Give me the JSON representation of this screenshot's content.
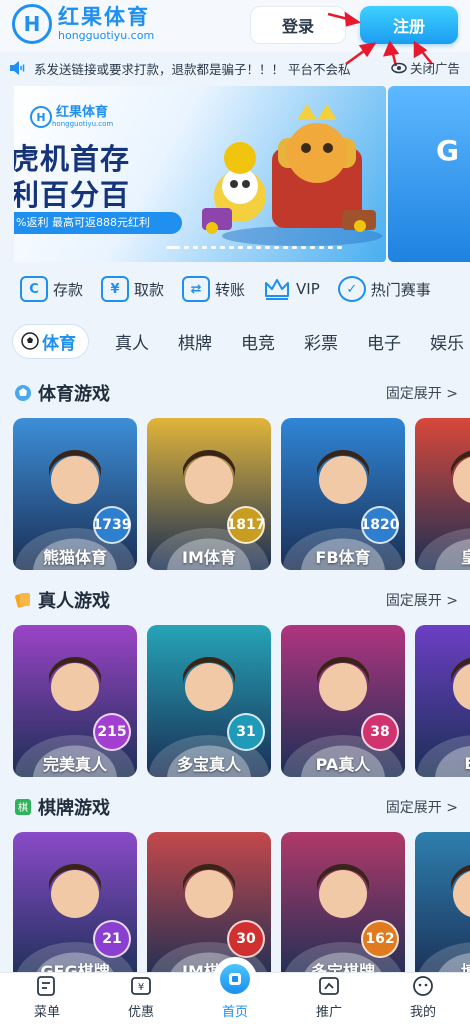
{
  "header": {
    "logo_mark": "H",
    "logo_title": "红果体育",
    "logo_sub": "hongguotiyu.com",
    "login_label": "登录",
    "register_label": "注册"
  },
  "marquee": {
    "text": "系发送链接或要求打款，退款都是骗子！！！ 平台不会私",
    "close_ad_label": "关闭广告",
    "icon": "speaker-icon"
  },
  "banner": {
    "logo_title": "红果体育",
    "logo_sub": "hongguotiyu.com",
    "headline_1": "虎机首存",
    "headline_2": "利百分百",
    "tag": "%返利 最高可返888元红利",
    "next_slide_text": "G"
  },
  "quick_actions": [
    {
      "label": "存款",
      "icon": "deposit-icon"
    },
    {
      "label": "取款",
      "icon": "withdraw-icon"
    },
    {
      "label": "转账",
      "icon": "transfer-icon"
    },
    {
      "label": "VIP",
      "icon": "crown-icon"
    },
    {
      "label": "热门赛事",
      "icon": "check-circle-icon"
    }
  ],
  "tabs": [
    {
      "label": "体育",
      "active": true
    },
    {
      "label": "真人"
    },
    {
      "label": "棋牌"
    },
    {
      "label": "电竞"
    },
    {
      "label": "彩票"
    },
    {
      "label": "电子"
    },
    {
      "label": "娱乐"
    }
  ],
  "sections": {
    "sports": {
      "title": "体育游戏",
      "more": "固定展开 >",
      "cards": [
        {
          "name": "熊猫体育",
          "count": "1739",
          "bg": "#3d8fd8",
          "badge": "#2f7fd0"
        },
        {
          "name": "IM体育",
          "count": "1817",
          "bg": "#e1b53a",
          "badge": "#c99d20"
        },
        {
          "name": "FB体育",
          "count": "1820",
          "bg": "#2f86d6",
          "badge": "#2f7fd0"
        },
        {
          "name": "皇冠",
          "count": "",
          "bg": "#d9483a",
          "badge": "#b33528"
        }
      ]
    },
    "live": {
      "title": "真人游戏",
      "more": "固定展开 >",
      "cards": [
        {
          "name": "完美真人",
          "count": "215",
          "bg": "#9b44c6",
          "badge": "#a23fd0"
        },
        {
          "name": "多宝真人",
          "count": "31",
          "bg": "#26a4b8",
          "badge": "#1f9ab8"
        },
        {
          "name": "PA真人",
          "count": "38",
          "bg": "#b0357f",
          "badge": "#d0336e"
        },
        {
          "name": "BG",
          "count": "",
          "bg": "#6c3fc4",
          "badge": "#5a2fb0"
        }
      ]
    },
    "cards_games": {
      "title": "棋牌游戏",
      "more": "固定展开 >",
      "cards": [
        {
          "name": "GEG棋牌",
          "count": "21",
          "bg": "#8a4bc8",
          "badge": "#8b3fd0"
        },
        {
          "name": "IM棋牌",
          "count": "30",
          "bg": "#c4484a",
          "badge": "#d03030"
        },
        {
          "name": "多宝棋牌",
          "count": "162",
          "bg": "#b0396a",
          "badge": "#e07a1f"
        },
        {
          "name": "博雅",
          "count": "",
          "bg": "#2e7fae",
          "badge": "#2f7fd0"
        }
      ]
    }
  },
  "bottom_nav": [
    {
      "label": "菜单",
      "icon": "menu-icon"
    },
    {
      "label": "优惠",
      "icon": "gift-icon"
    },
    {
      "label": "首页",
      "icon": "home-icon",
      "active": true
    },
    {
      "label": "推广",
      "icon": "share-icon"
    },
    {
      "label": "我的",
      "icon": "profile-icon"
    }
  ],
  "colors": {
    "accent": "#1f8ff0",
    "background": "#eef4fb",
    "annotation_red": "#e8192c"
  }
}
